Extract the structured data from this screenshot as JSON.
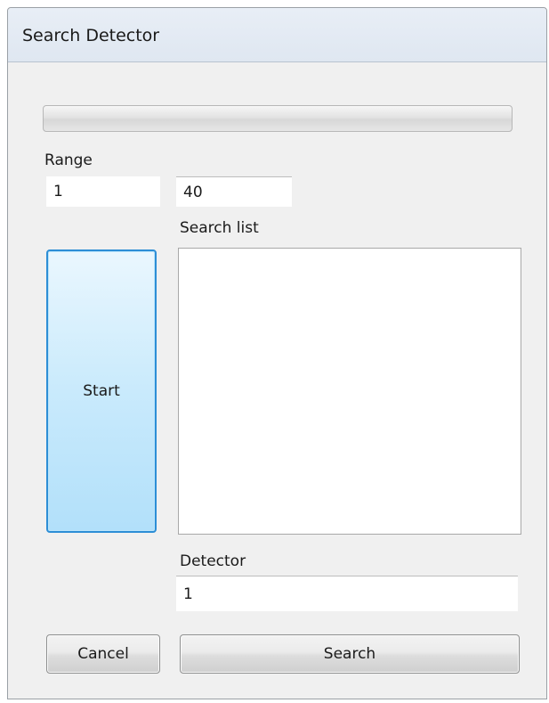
{
  "window": {
    "title": "Search Detector"
  },
  "progress": {
    "value_percent": 0
  },
  "range": {
    "label": "Range",
    "from_value": "1",
    "to_value": "40"
  },
  "search_list": {
    "label": "Search list",
    "items": []
  },
  "start_button": {
    "label": "Start"
  },
  "detector": {
    "label": "Detector",
    "value": "1"
  },
  "buttons": {
    "cancel_label": "Cancel",
    "search_label": "Search"
  },
  "colors": {
    "start_border": "#2d8ed6",
    "start_fill": "#c9eafc",
    "window_bg": "#f0f0f0"
  }
}
